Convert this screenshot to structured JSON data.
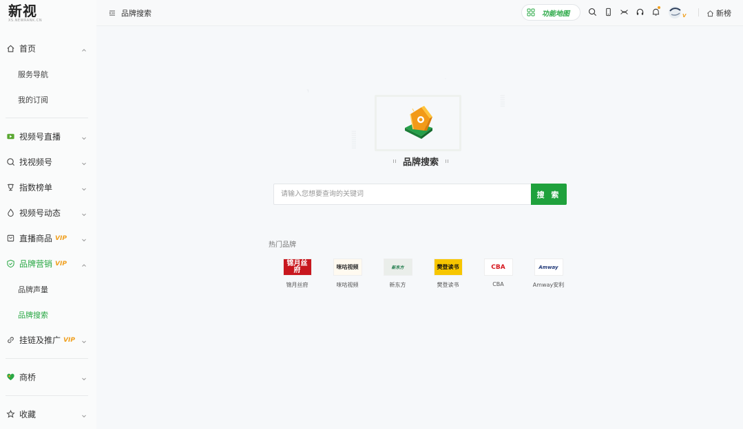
{
  "logo": {
    "main": "新视",
    "sub": "XS.NEWRANK.CN"
  },
  "sidebar": {
    "items": [
      {
        "label": "首页",
        "icon": "home-icon"
      },
      {
        "label": "服务导航"
      },
      {
        "label": "我的订阅"
      },
      {
        "label": "视频号直播",
        "icon": "live-icon"
      },
      {
        "label": "找视频号",
        "icon": "search-icon"
      },
      {
        "label": "指数榜单",
        "icon": "trophy-icon"
      },
      {
        "label": "视频号动态",
        "icon": "flame-icon"
      },
      {
        "label": "直播商品",
        "icon": "bag-icon",
        "badge": "VIP"
      },
      {
        "label": "品牌营销",
        "icon": "shield-icon",
        "badge": "VIP"
      },
      {
        "label": "品牌声量"
      },
      {
        "label": "品牌搜索"
      },
      {
        "label": "挂链及推广",
        "icon": "link-icon",
        "badge": "VIP"
      },
      {
        "label": "商桥",
        "icon": "heart-icon"
      },
      {
        "label": "收藏",
        "icon": "star-icon"
      }
    ]
  },
  "topbar": {
    "breadcrumb": "品牌搜索",
    "feature_map": "功能地图",
    "new_rank": "新榜"
  },
  "main": {
    "title": "品牌搜索",
    "search": {
      "placeholder": "请输入您想要查询的关键词",
      "button": "搜 索"
    },
    "hot_title": "热门品牌",
    "brands": [
      {
        "name": "锦月丝府",
        "logo_text": "锦月丝府"
      },
      {
        "name": "咪咕视频",
        "logo_text": "咪咕视频"
      },
      {
        "name": "新东方",
        "logo_text": "新东方"
      },
      {
        "name": "樊登读书",
        "logo_text": "樊登读书"
      },
      {
        "name": "CBA",
        "logo_text": "CBA"
      },
      {
        "name": "Amway安利",
        "logo_text": "Amway"
      }
    ]
  },
  "colors": {
    "accent": "#1fa13c",
    "vip": "#f0a020"
  }
}
